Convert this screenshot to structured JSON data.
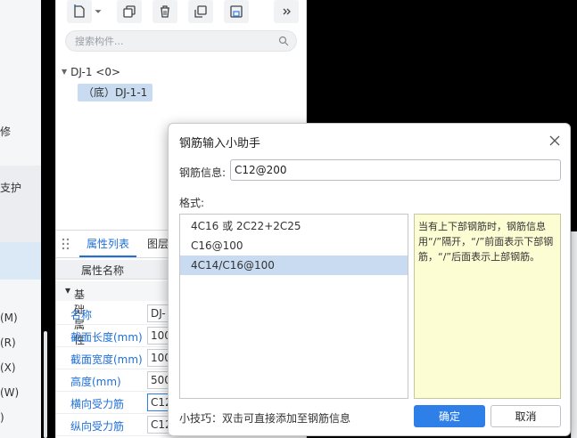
{
  "left_strip": {
    "items": [
      "修",
      "支护",
      "",
      "",
      "",
      "(M)",
      "(R)",
      "(X)",
      "(W)",
      ")"
    ]
  },
  "component_panel": {
    "toolbar_icons": [
      "new-component-icon",
      "dropdown-caret-icon",
      "copy-icon",
      "delete-icon",
      "duplicate-icon",
      "save-layer-icon",
      "more-icon"
    ],
    "search_placeholder": "搜索构件...",
    "tree": {
      "root": "DJ-1 <0>",
      "child": "（底）DJ-1-1"
    }
  },
  "property_panel": {
    "tabs": [
      "属性列表",
      "图层"
    ],
    "header": "属性名称",
    "group": "基础属性",
    "rows": [
      {
        "name": "名称",
        "value": "DJ-"
      },
      {
        "name": "截面长度(mm)",
        "value": "100"
      },
      {
        "name": "截面宽度(mm)",
        "value": "100"
      },
      {
        "name": "高度(mm)",
        "value": "500"
      },
      {
        "name": "横向受力筋",
        "value": "C12"
      },
      {
        "name": "纵向受力筋",
        "value": "C12"
      }
    ]
  },
  "dialog": {
    "title": "钢筋输入小助手",
    "info_label": "钢筋信息:",
    "info_value": "C12@200",
    "format_label": "格式:",
    "formats": [
      "4C16 或 2C22+2C25",
      "C16@100",
      "4C14/C16@100"
    ],
    "selected_format_index": 2,
    "help_text": "当有上下部钢筋时，钢筋信息用“/”隔开，“/”前面表示下部钢筋，“/”后面表示上部钢筋。",
    "tip": "小技巧：双击可直接添加至钢筋信息",
    "ok_label": "确定",
    "cancel_label": "取消",
    "accent_color": "#2f7fe8"
  }
}
